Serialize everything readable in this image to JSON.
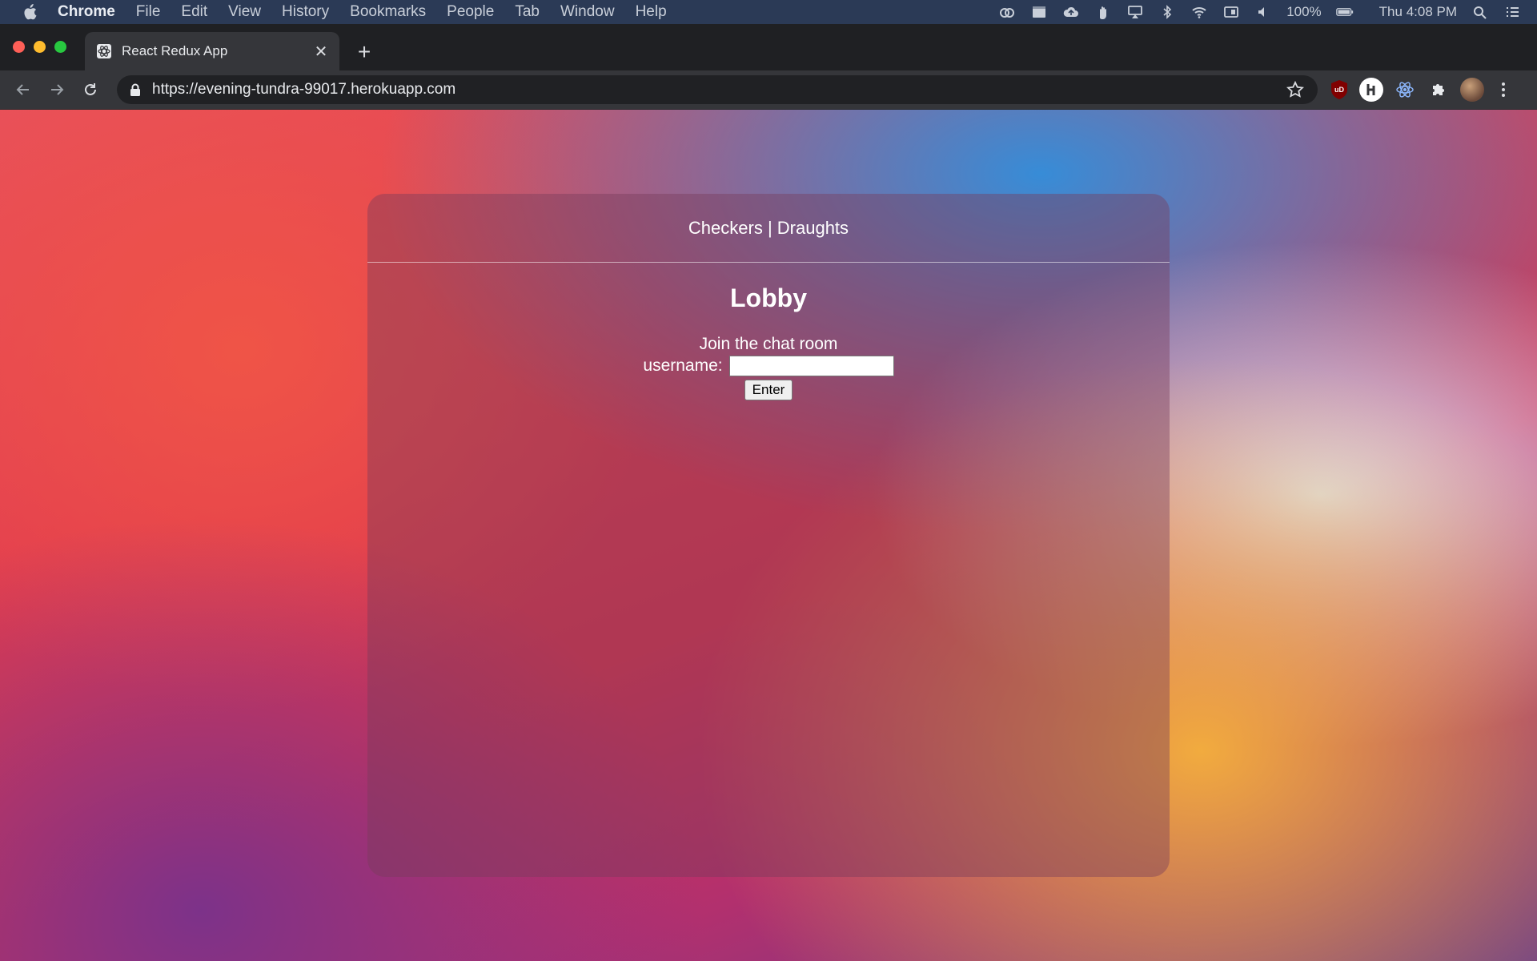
{
  "menubar": {
    "app_name": "Chrome",
    "items": [
      "File",
      "Edit",
      "View",
      "History",
      "Bookmarks",
      "People",
      "Tab",
      "Window",
      "Help"
    ],
    "battery": "100%",
    "clock": "Thu 4:08 PM"
  },
  "browser": {
    "tab_title": "React Redux App",
    "url": "https://evening-tundra-99017.herokuapp.com",
    "extensions": [
      "ublock-icon",
      "h-extension-icon",
      "react-devtools-icon",
      "puzzle-icon"
    ]
  },
  "page": {
    "header": "Checkers | Draughts",
    "lobby_title": "Lobby",
    "join_text": "Join the chat room",
    "username_label": "username:",
    "username_value": "",
    "enter_label": "Enter"
  }
}
